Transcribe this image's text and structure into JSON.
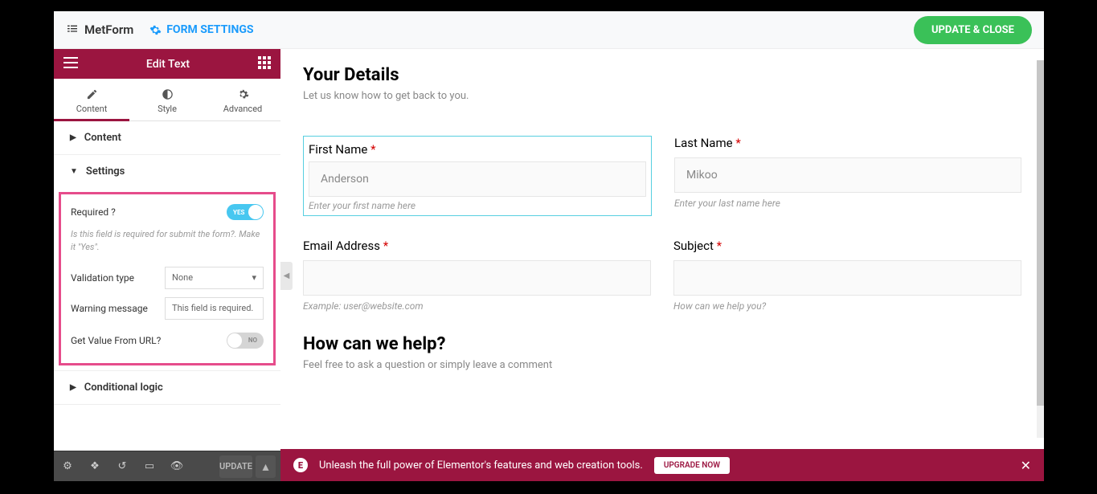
{
  "topbar": {
    "logo": "MetForm",
    "formSettings": "FORM SETTINGS",
    "updateClose": "UPDATE & CLOSE"
  },
  "sidebar": {
    "title": "Edit Text",
    "tabs": {
      "content": "Content",
      "style": "Style",
      "advanced": "Advanced"
    },
    "accordion": {
      "content": "Content",
      "settings": "Settings",
      "conditional": "Conditional logic"
    },
    "controls": {
      "requiredLabel": "Required ?",
      "requiredHelp": "Is this field is required for submit the form?. Make it \"Yes\".",
      "yes": "YES",
      "no": "NO",
      "validationLabel": "Validation type",
      "validationValue": "None",
      "warningLabel": "Warning message",
      "warningValue": "This field is required.",
      "getValueLabel": "Get Value From URL?"
    },
    "footer": {
      "update": "UPDATE"
    }
  },
  "preview": {
    "title1": "Your Details",
    "sub1": "Let us know how to get back to you.",
    "firstName": {
      "label": "First Name",
      "value": "Anderson",
      "hint": "Enter your first name here"
    },
    "lastName": {
      "label": "Last Name",
      "value": "Mikoo",
      "hint": "Enter your last name here"
    },
    "email": {
      "label": "Email Address",
      "hint": "Example: user@website.com"
    },
    "subject": {
      "label": "Subject",
      "hint": "How can we help you?"
    },
    "title2": "How can we help?",
    "sub2": "Feel free to ask a question or simply leave a comment"
  },
  "banner": {
    "text": "Unleash the full power of Elementor's features and web creation tools.",
    "button": "UPGRADE NOW"
  }
}
